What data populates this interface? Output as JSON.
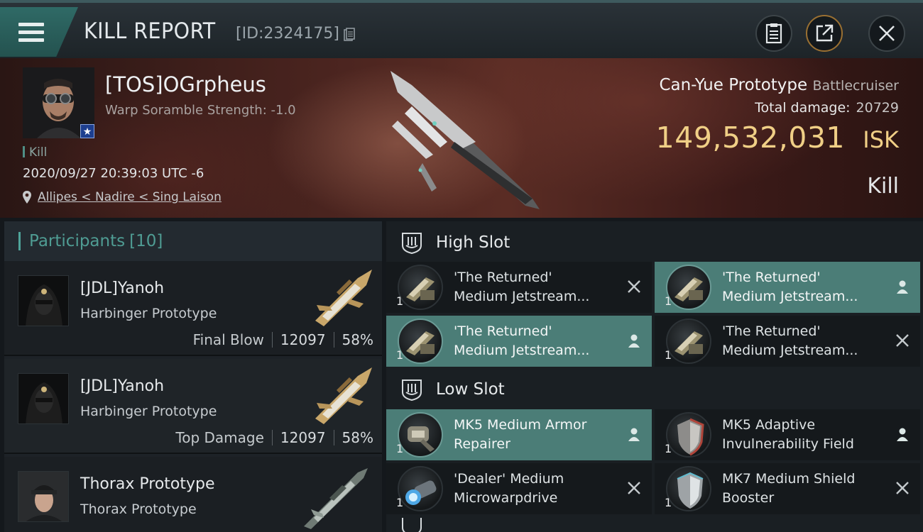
{
  "header": {
    "title": "KILL REPORT",
    "report_id": "[ID:2324175]",
    "menu_icon": "hamburger-menu-icon",
    "buttons": [
      "clipboard-icon",
      "share-external-icon",
      "close-icon"
    ]
  },
  "victim": {
    "name": "[TOS]OGrpheus",
    "scramble": "Warp Soramble Strength: -1.0",
    "tag": "Kill",
    "datetime": "2020/09/27 20:39:03 UTC -6",
    "location": "Allipes < Nadire < Sing Laison",
    "ship_name": "Can-Yue Prototype",
    "ship_class": "Battlecruiser",
    "total_damage_label": "Total damage:",
    "total_damage": "20729",
    "isk_value": "149,532,031",
    "isk_label": "ISK",
    "result": "Kill"
  },
  "participants": {
    "label": "Participants",
    "count": "[10]",
    "items": [
      {
        "name": "[JDL]Yanoh",
        "ship": "Harbinger Prototype",
        "stat_label": "Final Blow",
        "damage": "12097",
        "percent": "58%"
      },
      {
        "name": "[JDL]Yanoh",
        "ship": "Harbinger Prototype",
        "stat_label": "Top Damage",
        "damage": "12097",
        "percent": "58%"
      },
      {
        "name": "Thorax Prototype",
        "ship": "Thorax Prototype"
      }
    ]
  },
  "fitting": {
    "high_slot": {
      "title": "High Slot",
      "modules": [
        {
          "line1": "'The Returned'",
          "line2": "Medium Jetstream...",
          "qty": "1",
          "status": "destroyed-icon"
        },
        {
          "line1": "'The Returned'",
          "line2": "Medium Jetstream...",
          "qty": "1",
          "status": "dropped-icon"
        },
        {
          "line1": "'The Returned'",
          "line2": "Medium Jetstream...",
          "qty": "1",
          "status": "dropped-icon"
        },
        {
          "line1": "'The Returned'",
          "line2": "Medium Jetstream...",
          "qty": "1",
          "status": "destroyed-icon"
        }
      ]
    },
    "low_slot": {
      "title": "Low Slot",
      "modules": [
        {
          "line1": "MK5 Medium Armor",
          "line2": "Repairer",
          "qty": "1",
          "status": "dropped-icon"
        },
        {
          "line1": "MK5 Adaptive",
          "line2": "Invulnerability Field",
          "qty": "1",
          "status": "dropped-icon"
        },
        {
          "line1": "'Dealer' Medium",
          "line2": "Microwarpdrive",
          "qty": "1",
          "status": "destroyed-icon"
        },
        {
          "line1": "MK7 Medium Shield",
          "line2": "Booster",
          "qty": "1",
          "status": "destroyed-icon"
        }
      ]
    }
  },
  "colors": {
    "accent": "#4fa49a",
    "isk_gold": "#f0cf86",
    "highlight": "#4b7d77"
  }
}
